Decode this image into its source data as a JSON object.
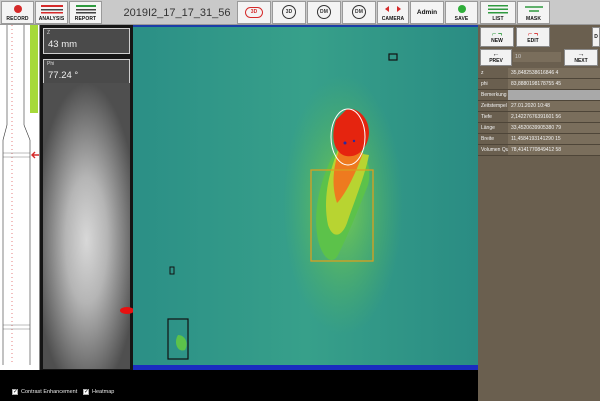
{
  "toolbar": {
    "buttons": [
      {
        "label": "RECORD"
      },
      {
        "label": "ANALYSIS"
      },
      {
        "label": "REPORT"
      },
      {
        "label": "3D"
      },
      {
        "label": "3D"
      },
      {
        "label": "DM"
      },
      {
        "label": "DM"
      },
      {
        "label": "CAMERA"
      },
      {
        "label": "SAVE"
      },
      {
        "label": "LIST"
      },
      {
        "label": "MASK"
      }
    ],
    "session_title": "2019I2_17_17_31_56",
    "user": "Admin"
  },
  "readouts": {
    "depth_label": "Z",
    "depth_value": "43  mm",
    "phi_label": "Phi",
    "phi_value": "77.24  °"
  },
  "right_panel": {
    "new_label": "NEW",
    "edit_label": "EDIT",
    "prev_label": "PREV",
    "next_label": "NEXT",
    "page_field": "10",
    "table": [
      {
        "key": "z",
        "value": "35,8482538616846 4"
      },
      {
        "key": "phi",
        "value": "83,8880198178755 45"
      },
      {
        "key": "Bemerkung",
        "value": ""
      },
      {
        "key": "Zeitstempel",
        "value": "27.01.2020 10:48"
      },
      {
        "key": "Tiefe",
        "value": "2,14227676391601 56"
      },
      {
        "key": "Länge",
        "value": "33,4520639905380 79"
      },
      {
        "key": "Breite",
        "value": "11,4584193141290 15"
      },
      {
        "key": "Volumen Quader",
        "value": "78,4141770849412 58"
      }
    ]
  },
  "bottom": {
    "contrast_label": "Contrast Enhancement",
    "heatmap_label": "Heatmap"
  },
  "colors": {
    "accent_red": "#d52a2a",
    "heatmap_bg": "#2f9a8a",
    "box_yellow": "#d9a020",
    "panel_brown": "#6a5f4f"
  }
}
